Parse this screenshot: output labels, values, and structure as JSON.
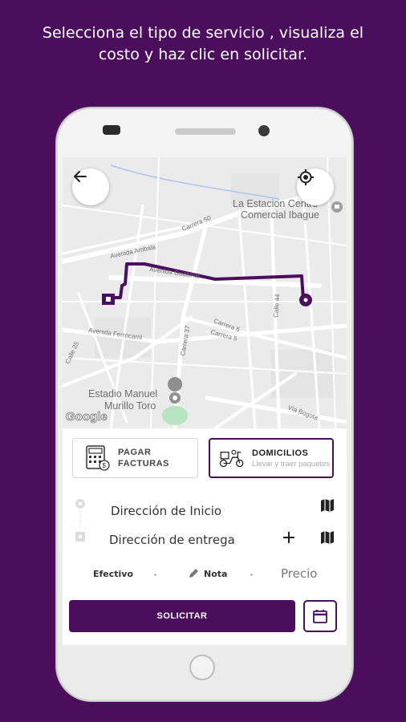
{
  "caption": {
    "line1": "Selecciona el tipo de servicio , visualiza el",
    "line2": "costo y  haz clic en solicitar."
  },
  "map": {
    "places": {
      "estacion_line1": "La Estacion Centro",
      "estacion_line2": "Comercial Ibague",
      "estadio_line1": "Estadio Manuel",
      "estadio_line2": "Murillo Toro"
    },
    "streets": {
      "carrera50": "Carrera 50",
      "ambala": "Avenida Ambala",
      "guabinal": "Avenida Guabinal",
      "calle44": "Calle 44",
      "carrera6": "Carrera 6",
      "carrera5": "Carrera 5",
      "ferrocarril": "Avenida Ferrocarril",
      "carrera37": "Carrera 37",
      "calle25": "Calle 25",
      "bogota": "Vía Bogota"
    },
    "google_logo": "Google",
    "route_color": "#4a0e5c"
  },
  "services": {
    "pagar": {
      "title_line1": "PAGAR",
      "title_line2": "FACTURAS",
      "icon": "calculator-bill-icon"
    },
    "domicilios": {
      "title": "DOMICILIOS",
      "subtitle": "Llevar y traer paquetes",
      "icon": "delivery-scooter-icon"
    }
  },
  "address": {
    "start_placeholder": "Dirección de Inicio",
    "delivery_placeholder": "Dirección de entrega"
  },
  "options": {
    "payment": "Efectivo",
    "note": "Nota",
    "price": "Precio"
  },
  "actions": {
    "solicitar": "SOLICITAR"
  },
  "colors": {
    "brand": "#4a0e5c",
    "background": "#4a0e5c"
  }
}
